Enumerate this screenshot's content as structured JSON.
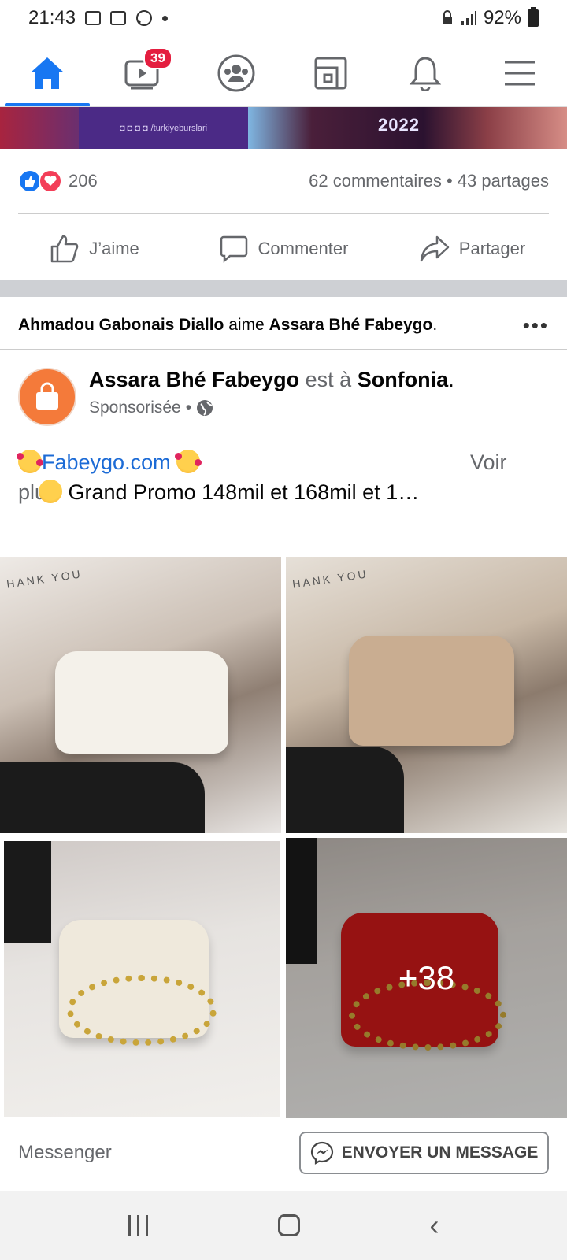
{
  "status_bar": {
    "time": "21:43",
    "battery": "92%"
  },
  "top_nav": {
    "items": [
      {
        "icon": "home-icon",
        "active": true
      },
      {
        "icon": "watch-icon",
        "badge": "39"
      },
      {
        "icon": "groups-icon"
      },
      {
        "icon": "pages-icon"
      },
      {
        "icon": "bell-icon"
      },
      {
        "icon": "menu-icon"
      }
    ]
  },
  "previous_post": {
    "banner_social_handle": "/turkiyeburslari",
    "banner_year": "2022",
    "reaction_count": "206",
    "stats": "62 commentaires • 43 partages",
    "actions": {
      "like": "J’aime",
      "comment": "Commenter",
      "share": "Partager"
    }
  },
  "social_context": {
    "friend_name": "Ahmadou Gabonais Diallo",
    "verb": "aime",
    "page_name": "Assara Bhé Fabeygo",
    "end": ".",
    "more": "•••"
  },
  "ad_post": {
    "page_name": "Assara Bhé Fabeygo",
    "location_prefix": "est à",
    "location": "Sonfonia",
    "location_suffix": ".",
    "sponsored": "Sponsorisée",
    "separator": "•",
    "text_link": "Fabeygo.com",
    "text_body": "Grand Promo 148mil et 168mil et 1…",
    "see_more": "Voir plus",
    "photos": [
      {
        "label": "HANK YOU"
      },
      {
        "label": "HANK YOU"
      },
      {
        "label": ""
      },
      {
        "overlay": "+38"
      }
    ],
    "cta_label": "Messenger",
    "cta_button": "ENVOYER UN MESSAGE"
  },
  "colors": {
    "accent": "#1877f2",
    "badge": "#e41e3f",
    "text_secondary": "#65676b"
  }
}
